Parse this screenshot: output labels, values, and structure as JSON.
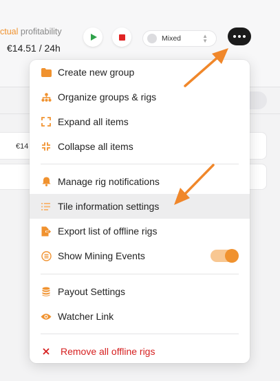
{
  "header": {
    "profitability_prefix": "ctual",
    "profitability_suffix": " profitability",
    "profit_value": "€14.51 / 24h",
    "mode_select_value": "Mixed"
  },
  "background": {
    "card_value": "€14"
  },
  "menu": {
    "items": [
      {
        "label": "Create new group",
        "icon": "folder-icon"
      },
      {
        "label": "Organize groups & rigs",
        "icon": "hierarchy-icon"
      },
      {
        "label": "Expand all items",
        "icon": "expand-icon"
      },
      {
        "label": "Collapse all items",
        "icon": "collapse-icon"
      },
      {
        "label": "Manage rig notifications",
        "icon": "bell-icon"
      },
      {
        "label": "Tile information settings",
        "icon": "list-settings-icon"
      },
      {
        "label": "Export list of offline rigs",
        "icon": "file-export-icon"
      },
      {
        "label": "Show Mining Events",
        "icon": "events-icon"
      },
      {
        "label": "Payout Settings",
        "icon": "coins-icon"
      },
      {
        "label": "Watcher Link",
        "icon": "eye-icon"
      },
      {
        "label": "Remove all offline rigs",
        "icon": "close-icon"
      }
    ],
    "show_mining_events_enabled": true
  },
  "colors": {
    "accent": "#f0922f",
    "danger": "#d61f1f",
    "play": "#2fa24a",
    "stop": "#e02424",
    "arrow": "#f0872a"
  }
}
